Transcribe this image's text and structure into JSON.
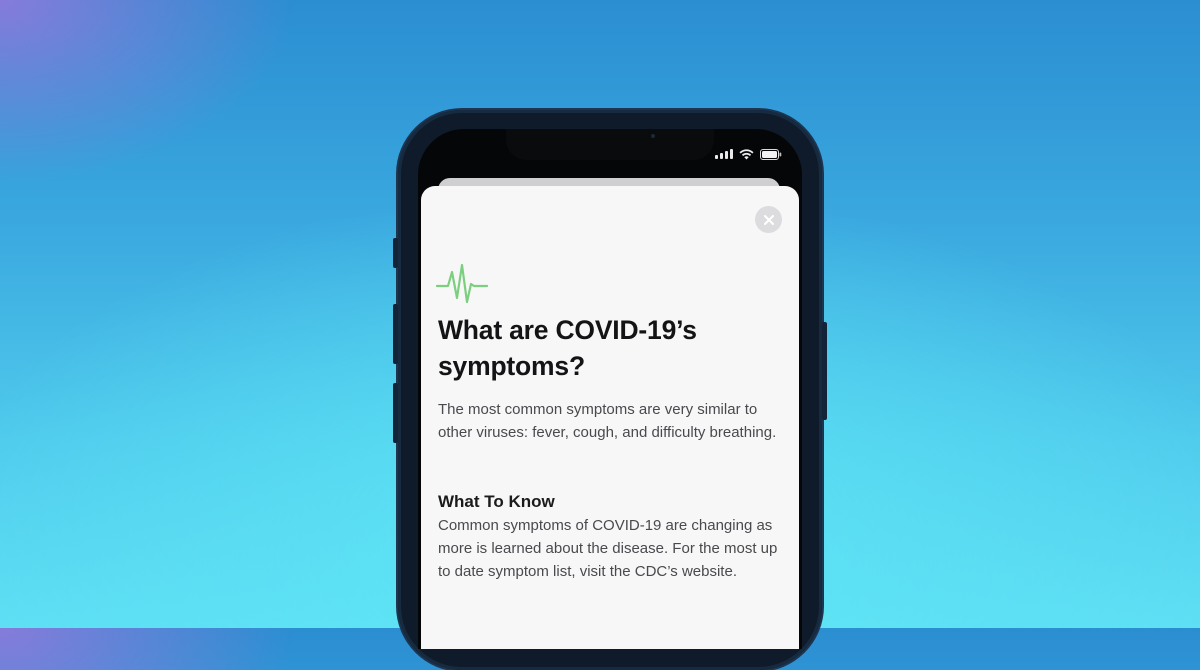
{
  "article": {
    "title": "What are COVID-19’s symptoms?",
    "intro": "The most common symptoms are very similar to other viruses: fever, cough, and difficulty breathing.",
    "section_heading": "What To Know",
    "section_body": "Common symptoms of COVID-19 are changing as more is learned about the disease. For the most up to date symptom list, visit the CDC’s website."
  },
  "icons": {
    "header": "heartbeat-icon",
    "close": "close-icon",
    "status": [
      "cellular-signal-icon",
      "wifi-icon",
      "battery-icon"
    ]
  },
  "colors": {
    "heartbeat_accent": "#7ccf7f",
    "background_top": "#2b8ed1",
    "background_bottom": "#5fdff4",
    "sheet": "#f7f7f8"
  }
}
